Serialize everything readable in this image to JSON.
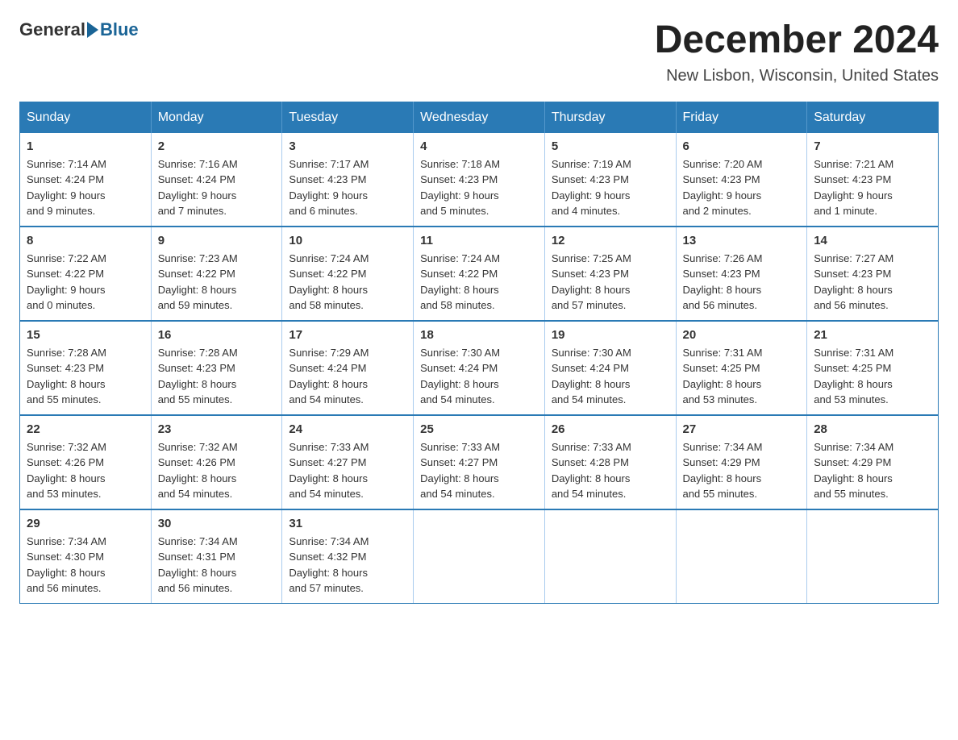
{
  "logo": {
    "general": "General",
    "blue": "Blue"
  },
  "title": "December 2024",
  "subtitle": "New Lisbon, Wisconsin, United States",
  "headers": [
    "Sunday",
    "Monday",
    "Tuesday",
    "Wednesday",
    "Thursday",
    "Friday",
    "Saturday"
  ],
  "weeks": [
    [
      {
        "day": "1",
        "sunrise": "7:14 AM",
        "sunset": "4:24 PM",
        "daylight": "9 hours and 9 minutes."
      },
      {
        "day": "2",
        "sunrise": "7:16 AM",
        "sunset": "4:24 PM",
        "daylight": "9 hours and 7 minutes."
      },
      {
        "day": "3",
        "sunrise": "7:17 AM",
        "sunset": "4:23 PM",
        "daylight": "9 hours and 6 minutes."
      },
      {
        "day": "4",
        "sunrise": "7:18 AM",
        "sunset": "4:23 PM",
        "daylight": "9 hours and 5 minutes."
      },
      {
        "day": "5",
        "sunrise": "7:19 AM",
        "sunset": "4:23 PM",
        "daylight": "9 hours and 4 minutes."
      },
      {
        "day": "6",
        "sunrise": "7:20 AM",
        "sunset": "4:23 PM",
        "daylight": "9 hours and 2 minutes."
      },
      {
        "day": "7",
        "sunrise": "7:21 AM",
        "sunset": "4:23 PM",
        "daylight": "9 hours and 1 minute."
      }
    ],
    [
      {
        "day": "8",
        "sunrise": "7:22 AM",
        "sunset": "4:22 PM",
        "daylight": "9 hours and 0 minutes."
      },
      {
        "day": "9",
        "sunrise": "7:23 AM",
        "sunset": "4:22 PM",
        "daylight": "8 hours and 59 minutes."
      },
      {
        "day": "10",
        "sunrise": "7:24 AM",
        "sunset": "4:22 PM",
        "daylight": "8 hours and 58 minutes."
      },
      {
        "day": "11",
        "sunrise": "7:24 AM",
        "sunset": "4:22 PM",
        "daylight": "8 hours and 58 minutes."
      },
      {
        "day": "12",
        "sunrise": "7:25 AM",
        "sunset": "4:23 PM",
        "daylight": "8 hours and 57 minutes."
      },
      {
        "day": "13",
        "sunrise": "7:26 AM",
        "sunset": "4:23 PM",
        "daylight": "8 hours and 56 minutes."
      },
      {
        "day": "14",
        "sunrise": "7:27 AM",
        "sunset": "4:23 PM",
        "daylight": "8 hours and 56 minutes."
      }
    ],
    [
      {
        "day": "15",
        "sunrise": "7:28 AM",
        "sunset": "4:23 PM",
        "daylight": "8 hours and 55 minutes."
      },
      {
        "day": "16",
        "sunrise": "7:28 AM",
        "sunset": "4:23 PM",
        "daylight": "8 hours and 55 minutes."
      },
      {
        "day": "17",
        "sunrise": "7:29 AM",
        "sunset": "4:24 PM",
        "daylight": "8 hours and 54 minutes."
      },
      {
        "day": "18",
        "sunrise": "7:30 AM",
        "sunset": "4:24 PM",
        "daylight": "8 hours and 54 minutes."
      },
      {
        "day": "19",
        "sunrise": "7:30 AM",
        "sunset": "4:24 PM",
        "daylight": "8 hours and 54 minutes."
      },
      {
        "day": "20",
        "sunrise": "7:31 AM",
        "sunset": "4:25 PM",
        "daylight": "8 hours and 53 minutes."
      },
      {
        "day": "21",
        "sunrise": "7:31 AM",
        "sunset": "4:25 PM",
        "daylight": "8 hours and 53 minutes."
      }
    ],
    [
      {
        "day": "22",
        "sunrise": "7:32 AM",
        "sunset": "4:26 PM",
        "daylight": "8 hours and 53 minutes."
      },
      {
        "day": "23",
        "sunrise": "7:32 AM",
        "sunset": "4:26 PM",
        "daylight": "8 hours and 54 minutes."
      },
      {
        "day": "24",
        "sunrise": "7:33 AM",
        "sunset": "4:27 PM",
        "daylight": "8 hours and 54 minutes."
      },
      {
        "day": "25",
        "sunrise": "7:33 AM",
        "sunset": "4:27 PM",
        "daylight": "8 hours and 54 minutes."
      },
      {
        "day": "26",
        "sunrise": "7:33 AM",
        "sunset": "4:28 PM",
        "daylight": "8 hours and 54 minutes."
      },
      {
        "day": "27",
        "sunrise": "7:34 AM",
        "sunset": "4:29 PM",
        "daylight": "8 hours and 55 minutes."
      },
      {
        "day": "28",
        "sunrise": "7:34 AM",
        "sunset": "4:29 PM",
        "daylight": "8 hours and 55 minutes."
      }
    ],
    [
      {
        "day": "29",
        "sunrise": "7:34 AM",
        "sunset": "4:30 PM",
        "daylight": "8 hours and 56 minutes."
      },
      {
        "day": "30",
        "sunrise": "7:34 AM",
        "sunset": "4:31 PM",
        "daylight": "8 hours and 56 minutes."
      },
      {
        "day": "31",
        "sunrise": "7:34 AM",
        "sunset": "4:32 PM",
        "daylight": "8 hours and 57 minutes."
      },
      null,
      null,
      null,
      null
    ]
  ],
  "labels": {
    "sunrise": "Sunrise:",
    "sunset": "Sunset:",
    "daylight": "Daylight:"
  }
}
